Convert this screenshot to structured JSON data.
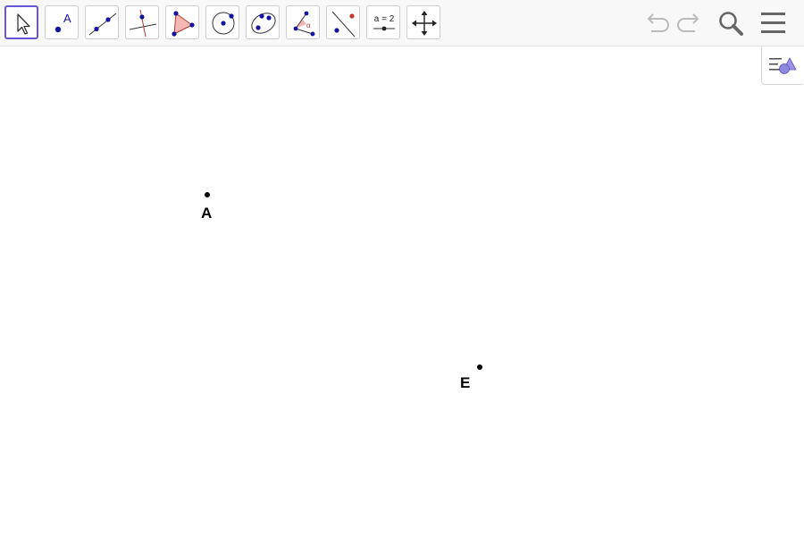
{
  "toolbar": {
    "tools": [
      {
        "id": "move",
        "icon": "move-arrow-icon",
        "selected": true
      },
      {
        "id": "point",
        "icon": "point-icon",
        "glyph": "A"
      },
      {
        "id": "line",
        "icon": "line-icon"
      },
      {
        "id": "perpendicular",
        "icon": "perpendicular-line-icon"
      },
      {
        "id": "polygon",
        "icon": "polygon-icon"
      },
      {
        "id": "circle",
        "icon": "circle-center-point-icon"
      },
      {
        "id": "conic",
        "icon": "ellipse-icon"
      },
      {
        "id": "angle",
        "icon": "angle-icon",
        "glyph": "α"
      },
      {
        "id": "reflect",
        "icon": "reflect-line-icon"
      },
      {
        "id": "slider",
        "icon": "slider-icon",
        "glyph": "a = 2"
      },
      {
        "id": "move-view",
        "icon": "move-graphics-view-icon"
      }
    ],
    "undo": {
      "icon": "undo-icon",
      "enabled": false
    },
    "redo": {
      "icon": "redo-icon",
      "enabled": false
    },
    "search": {
      "icon": "search-icon"
    },
    "menu": {
      "icon": "hamburger-menu-icon"
    }
  },
  "style_bar_toggle": {
    "icon": "style-bar-toggle-icon"
  },
  "colors": {
    "accent": "#6557d2",
    "point_blue": "#1414a0",
    "disabled": "#bbbbbb",
    "icon_dark": "#666666"
  },
  "points": [
    {
      "name": "A",
      "label": "A"
    },
    {
      "name": "E",
      "label": "E"
    }
  ]
}
